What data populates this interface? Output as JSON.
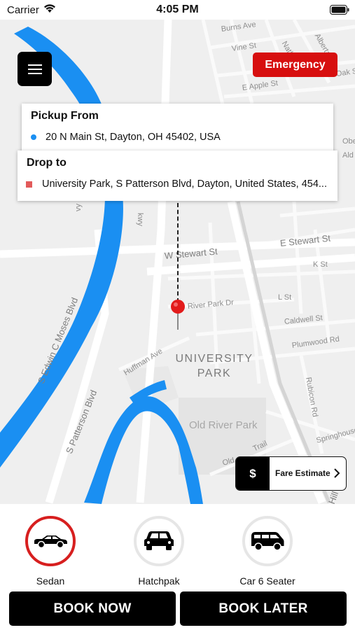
{
  "status_bar": {
    "carrier": "Carrier",
    "time": "4:05 PM",
    "icons": [
      "wifi-icon",
      "battery-icon"
    ]
  },
  "map": {
    "street_labels": [
      "Burns Ave",
      "Nathan Pl",
      "Alberta St",
      "Vine St",
      "E Apple St",
      "Oak S",
      "Obe",
      "Ald",
      "E Stewart St",
      "W Stewart St",
      "K St",
      "L St",
      "River Park Dr",
      "Caldwell St",
      "Plumwood Rd",
      "Huffman Ave",
      "Rubicon Rd",
      "Springhouse",
      "Old",
      "Trail",
      "S Edwin C Moses Blvd",
      "S Patterson Blvd",
      "vy",
      "kwy",
      "Hill"
    ],
    "area_label_line1": "UNIVERSITY",
    "area_label_line2": "PARK",
    "park_label": "Old River Park",
    "colors": {
      "water": "#1a8ff2",
      "road": "#ffffff",
      "land": "#efefef",
      "park": "#e6e6e6"
    }
  },
  "menu": {
    "icon": "hamburger-menu-icon"
  },
  "emergency": {
    "label": "Emergency",
    "color": "#d70f0f"
  },
  "pickup": {
    "title": "Pickup From",
    "address": "20 N Main St, Dayton, OH 45402, USA",
    "marker_color": "#1a8ff2"
  },
  "drop": {
    "title": "Drop to",
    "address": "University Park, S Patterson Blvd, Dayton, United States, 454...",
    "marker_color": "#e25a5a"
  },
  "destination_pin": {
    "icon": "map-pin-icon",
    "color": "#e21b1b"
  },
  "fare": {
    "symbol": "$",
    "label": "Fare Estimate",
    "chevron_icon": "chevron-right-icon"
  },
  "vehicles": [
    {
      "label": "Sedan",
      "icon": "sedan-car-icon",
      "selected": true
    },
    {
      "label": "Hatchpak",
      "icon": "hatchback-car-icon",
      "selected": false
    },
    {
      "label": "Car 6 Seater",
      "icon": "van-icon",
      "selected": false
    }
  ],
  "actions": {
    "book_now": "BOOK NOW",
    "book_later": "BOOK LATER"
  },
  "accent_colors": {
    "selected_ring": "#d71f1f",
    "button_bg": "#000000"
  }
}
